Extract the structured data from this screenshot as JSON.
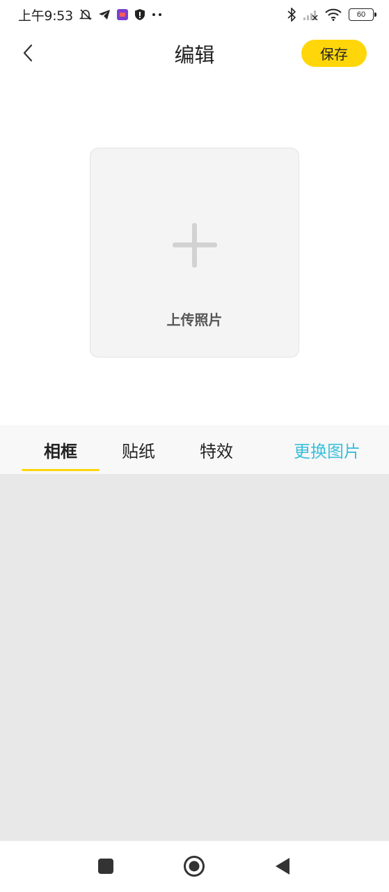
{
  "status_bar": {
    "time": "上午9:53",
    "icons": [
      "mute-bell-icon",
      "telegram-icon",
      "app-icon",
      "shield-icon",
      "more-dots-icon",
      "bluetooth-icon",
      "signal-icon",
      "wifi-icon",
      "battery-icon"
    ],
    "battery_level": "60"
  },
  "header": {
    "title": "编辑",
    "back_icon": "chevron-left-icon",
    "save_label": "保存"
  },
  "upload": {
    "icon": "plus-icon",
    "label": "上传照片"
  },
  "tabs": [
    {
      "label": "相框",
      "active": true
    },
    {
      "label": "贴纸",
      "active": false
    },
    {
      "label": "特效",
      "active": false
    }
  ],
  "change_image_label": "更换图片",
  "nav_bar": {
    "icons": [
      "recents-square-icon",
      "home-circle-icon",
      "back-triangle-icon"
    ]
  },
  "colors": {
    "accent_yellow": "#ffd60a",
    "link_blue": "#3cbfdb",
    "content_gray": "#e8e8e8"
  }
}
